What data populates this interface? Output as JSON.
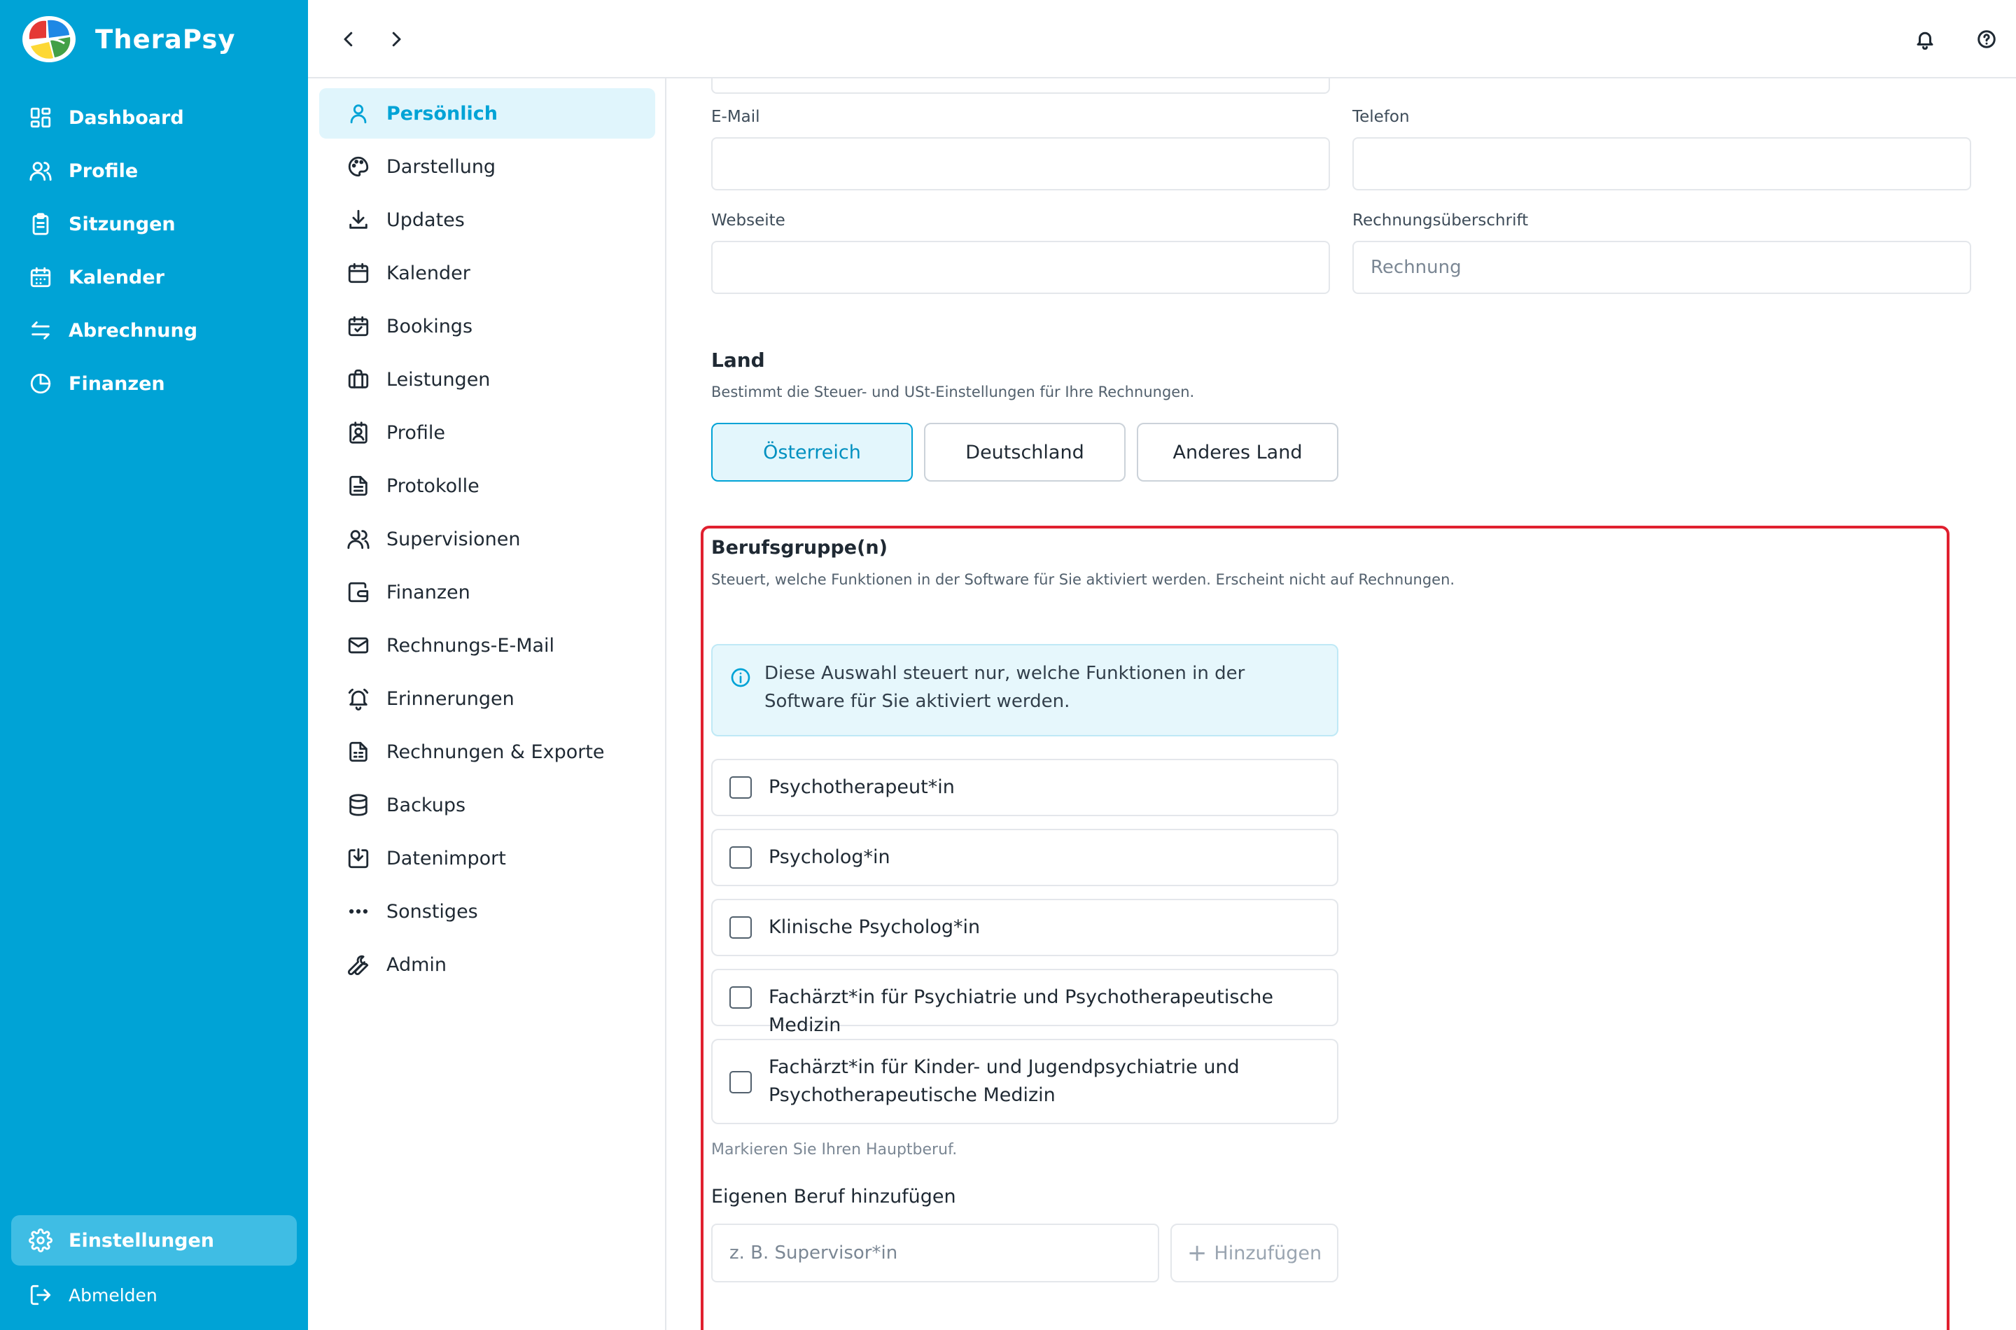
{
  "app": {
    "name": "TheraPsy"
  },
  "sidebar": {
    "items": [
      {
        "label": "Dashboard",
        "icon": "dashboard-icon"
      },
      {
        "label": "Profile",
        "icon": "users-icon"
      },
      {
        "label": "Sitzungen",
        "icon": "clipboard-icon"
      },
      {
        "label": "Kalender",
        "icon": "calendar-icon"
      },
      {
        "label": "Abrechnung",
        "icon": "arrows-exchange-icon"
      },
      {
        "label": "Finanzen",
        "icon": "pie-chart-icon"
      }
    ],
    "settings_label": "Einstellungen",
    "logout_label": "Abmelden"
  },
  "settings_menu": {
    "items": [
      {
        "label": "Persönlich",
        "icon": "user-icon",
        "active": true
      },
      {
        "label": "Darstellung",
        "icon": "palette-icon"
      },
      {
        "label": "Updates",
        "icon": "download-icon"
      },
      {
        "label": "Kalender",
        "icon": "calendar-icon"
      },
      {
        "label": "Bookings",
        "icon": "calendar-check-icon"
      },
      {
        "label": "Leistungen",
        "icon": "briefcase-icon"
      },
      {
        "label": "Profile",
        "icon": "contact-card-icon"
      },
      {
        "label": "Protokolle",
        "icon": "document-icon"
      },
      {
        "label": "Supervisionen",
        "icon": "users-icon"
      },
      {
        "label": "Finanzen",
        "icon": "wallet-icon"
      },
      {
        "label": "Rechnungs-E-Mail",
        "icon": "mail-icon"
      },
      {
        "label": "Erinnerungen",
        "icon": "bell-ring-icon"
      },
      {
        "label": "Rechnungen & Exporte",
        "icon": "spreadsheet-icon"
      },
      {
        "label": "Backups",
        "icon": "database-icon"
      },
      {
        "label": "Datenimport",
        "icon": "import-icon"
      },
      {
        "label": "Sonstiges",
        "icon": "more-horizontal-icon"
      },
      {
        "label": "Admin",
        "icon": "wrench-icon"
      }
    ]
  },
  "form": {
    "email_label": "E-Mail",
    "email_value": "",
    "phone_label": "Telefon",
    "phone_value": "",
    "website_label": "Webseite",
    "website_value": "",
    "invoice_heading_label": "Rechnungsüberschrift",
    "invoice_heading_placeholder": "Rechnung"
  },
  "country": {
    "title": "Land",
    "subtitle": "Bestimmt die Steuer- und USt-Einstellungen für Ihre Rechnungen.",
    "options": [
      "Österreich",
      "Deutschland",
      "Anderes Land"
    ],
    "selected": "Österreich"
  },
  "profession": {
    "title": "Berufsgruppe(n)",
    "subtitle": "Steuert, welche Funktionen in der Software für Sie aktiviert werden. Erscheint nicht auf Rechnungen.",
    "info_text": "Diese Auswahl steuert nur, welche Funktionen in der Software für Sie aktiviert werden.",
    "options": [
      {
        "label": "Psychotherapeut*in",
        "checked": false
      },
      {
        "label": "Psycholog*in",
        "checked": false
      },
      {
        "label": "Klinische Psycholog*in",
        "checked": false
      },
      {
        "label": "Fachärzt*in für Psychiatrie und Psychotherapeutische Medizin",
        "checked": false
      },
      {
        "label": "Fachärzt*in für Kinder- und Jugendpsychiatrie und Psychotherapeutische Medizin",
        "checked": false
      }
    ],
    "hint": "Markieren Sie Ihren Hauptberuf.",
    "custom_title": "Eigenen Beruf hinzufügen",
    "custom_placeholder": "z. B. Supervisor*in",
    "add_label": "Hinzufügen"
  },
  "colors": {
    "primary": "#00a3d6",
    "active_bg": "#e0f5fc",
    "highlight": "#e0202f"
  }
}
